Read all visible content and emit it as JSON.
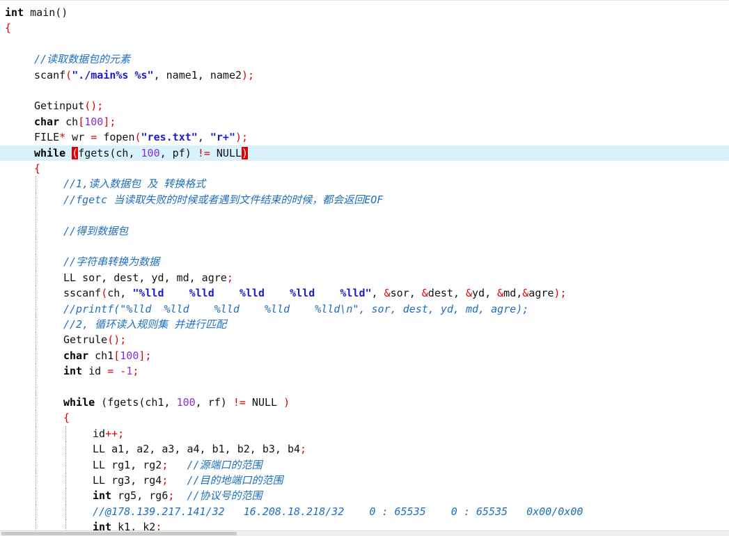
{
  "editor": {
    "lines": [
      {
        "indent": 0,
        "tokens": [
          {
            "k": "kw",
            "t": "int"
          },
          {
            "k": "plain",
            "t": " main()"
          }
        ]
      },
      {
        "indent": 0,
        "tokens": [
          {
            "k": "brace",
            "t": "{"
          }
        ]
      },
      {
        "indent": 0,
        "tokens": []
      },
      {
        "indent": 1,
        "tokens": [
          {
            "k": "cmt",
            "t": "//读取数据包的元素"
          }
        ]
      },
      {
        "indent": 1,
        "tokens": [
          {
            "k": "plain",
            "t": "scanf"
          },
          {
            "k": "op",
            "t": "("
          },
          {
            "k": "str",
            "t": "\"./main%s %s\""
          },
          {
            "k": "plain",
            "t": ", name1, name2"
          },
          {
            "k": "op",
            "t": ");"
          }
        ]
      },
      {
        "indent": 0,
        "tokens": []
      },
      {
        "indent": 1,
        "tokens": [
          {
            "k": "plain",
            "t": "Getinput"
          },
          {
            "k": "op",
            "t": "();"
          }
        ]
      },
      {
        "indent": 1,
        "tokens": [
          {
            "k": "kw",
            "t": "char"
          },
          {
            "k": "plain",
            "t": " ch"
          },
          {
            "k": "op",
            "t": "["
          },
          {
            "k": "num",
            "t": "100"
          },
          {
            "k": "op",
            "t": "];"
          }
        ]
      },
      {
        "indent": 1,
        "tokens": [
          {
            "k": "plain",
            "t": "FILE"
          },
          {
            "k": "op",
            "t": "*"
          },
          {
            "k": "plain",
            "t": " wr "
          },
          {
            "k": "op",
            "t": "="
          },
          {
            "k": "plain",
            "t": " fopen"
          },
          {
            "k": "op",
            "t": "("
          },
          {
            "k": "str",
            "t": "\"res.txt\""
          },
          {
            "k": "plain",
            "t": ", "
          },
          {
            "k": "str",
            "t": "\"r+\""
          },
          {
            "k": "op",
            "t": ");"
          }
        ]
      },
      {
        "indent": 1,
        "current": true,
        "tokens": [
          {
            "k": "kw",
            "t": "while"
          },
          {
            "k": "plain",
            "t": " "
          },
          {
            "k": "hl",
            "t": "("
          },
          {
            "k": "plain",
            "t": "fgets(ch, "
          },
          {
            "k": "num",
            "t": "100"
          },
          {
            "k": "plain",
            "t": ", pf) "
          },
          {
            "k": "op",
            "t": "!="
          },
          {
            "k": "plain",
            "t": " NULL"
          },
          {
            "k": "hl",
            "t": ")"
          }
        ]
      },
      {
        "indent": 1,
        "tokens": [
          {
            "k": "brace",
            "t": "{"
          }
        ]
      },
      {
        "indent": 2,
        "tokens": [
          {
            "k": "cmt",
            "t": "//1,读入数据包 及 转换格式"
          }
        ]
      },
      {
        "indent": 2,
        "tokens": [
          {
            "k": "cmt",
            "t": "//fgetc 当读取失败的时候或者遇到文件结束的时候，都会返回EOF"
          }
        ]
      },
      {
        "indent": 0,
        "tokens": []
      },
      {
        "indent": 2,
        "tokens": [
          {
            "k": "cmt",
            "t": "//得到数据包"
          }
        ]
      },
      {
        "indent": 0,
        "tokens": []
      },
      {
        "indent": 2,
        "tokens": [
          {
            "k": "cmt",
            "t": "//字符串转换为数据"
          }
        ]
      },
      {
        "indent": 2,
        "tokens": [
          {
            "k": "plain",
            "t": "LL sor, dest, yd, md, agre"
          },
          {
            "k": "op",
            "t": ";"
          }
        ]
      },
      {
        "indent": 2,
        "tokens": [
          {
            "k": "plain",
            "t": "sscanf"
          },
          {
            "k": "op",
            "t": "("
          },
          {
            "k": "plain",
            "t": "ch, "
          },
          {
            "k": "str",
            "t": "\"%lld    %lld    %lld    %lld    %lld\""
          },
          {
            "k": "plain",
            "t": ", "
          },
          {
            "k": "op",
            "t": "&"
          },
          {
            "k": "plain",
            "t": "sor, "
          },
          {
            "k": "op",
            "t": "&"
          },
          {
            "k": "plain",
            "t": "dest, "
          },
          {
            "k": "op",
            "t": "&"
          },
          {
            "k": "plain",
            "t": "yd, "
          },
          {
            "k": "op",
            "t": "&"
          },
          {
            "k": "plain",
            "t": "md,"
          },
          {
            "k": "op",
            "t": "&"
          },
          {
            "k": "plain",
            "t": "agre"
          },
          {
            "k": "op",
            "t": ");"
          }
        ]
      },
      {
        "indent": 2,
        "tokens": [
          {
            "k": "cmt",
            "t": "//printf(\"%lld  %lld    %lld    %lld    %lld\\n\", sor, dest, yd, md, agre);"
          }
        ]
      },
      {
        "indent": 2,
        "tokens": [
          {
            "k": "cmt",
            "t": "//2, 循环读入规则集 并进行匹配"
          }
        ]
      },
      {
        "indent": 2,
        "tokens": [
          {
            "k": "plain",
            "t": "Getrule"
          },
          {
            "k": "op",
            "t": "();"
          }
        ]
      },
      {
        "indent": 2,
        "tokens": [
          {
            "k": "kw",
            "t": "char"
          },
          {
            "k": "plain",
            "t": " ch1"
          },
          {
            "k": "op",
            "t": "["
          },
          {
            "k": "num",
            "t": "100"
          },
          {
            "k": "op",
            "t": "];"
          }
        ]
      },
      {
        "indent": 2,
        "tokens": [
          {
            "k": "kw",
            "t": "int"
          },
          {
            "k": "plain",
            "t": " id "
          },
          {
            "k": "op",
            "t": "="
          },
          {
            "k": "plain",
            "t": " "
          },
          {
            "k": "op",
            "t": "-"
          },
          {
            "k": "num",
            "t": "1"
          },
          {
            "k": "op",
            "t": ";"
          }
        ]
      },
      {
        "indent": 0,
        "tokens": []
      },
      {
        "indent": 2,
        "tokens": [
          {
            "k": "kw",
            "t": "while"
          },
          {
            "k": "plain",
            "t": " (fgets(ch1, "
          },
          {
            "k": "num",
            "t": "100"
          },
          {
            "k": "plain",
            "t": ", rf) "
          },
          {
            "k": "op",
            "t": "!="
          },
          {
            "k": "plain",
            "t": " NULL "
          },
          {
            "k": "op",
            "t": ")"
          }
        ]
      },
      {
        "indent": 2,
        "tokens": [
          {
            "k": "brace",
            "t": "{"
          }
        ]
      },
      {
        "indent": 3,
        "tokens": [
          {
            "k": "plain",
            "t": "id"
          },
          {
            "k": "op",
            "t": "++;"
          }
        ]
      },
      {
        "indent": 3,
        "tokens": [
          {
            "k": "plain",
            "t": "LL a1, a2, a3, a4, b1, b2, b3, b4"
          },
          {
            "k": "op",
            "t": ";"
          }
        ]
      },
      {
        "indent": 3,
        "tokens": [
          {
            "k": "plain",
            "t": "LL rg1, rg2"
          },
          {
            "k": "op",
            "t": ";"
          },
          {
            "k": "plain",
            "t": "   "
          },
          {
            "k": "cmt",
            "t": "//源端口的范围"
          }
        ]
      },
      {
        "indent": 3,
        "tokens": [
          {
            "k": "plain",
            "t": "LL rg3, rg4"
          },
          {
            "k": "op",
            "t": ";"
          },
          {
            "k": "plain",
            "t": "   "
          },
          {
            "k": "cmt",
            "t": "//目的地端口的范围"
          }
        ]
      },
      {
        "indent": 3,
        "tokens": [
          {
            "k": "kw",
            "t": "int"
          },
          {
            "k": "plain",
            "t": " rg5, rg6"
          },
          {
            "k": "op",
            "t": ";"
          },
          {
            "k": "plain",
            "t": "  "
          },
          {
            "k": "cmt",
            "t": "//协议号的范围"
          }
        ]
      },
      {
        "indent": 3,
        "tokens": [
          {
            "k": "cmt",
            "t": "//@178.139.217.141/32   16.208.18.218/32    0 : 65535    0 : 65535   0x00/0x00"
          }
        ]
      },
      {
        "indent": 3,
        "tokens": [
          {
            "k": "kw",
            "t": "int"
          },
          {
            "k": "plain",
            "t": " k1, k2"
          },
          {
            "k": "op",
            "t": ";"
          }
        ]
      }
    ]
  }
}
